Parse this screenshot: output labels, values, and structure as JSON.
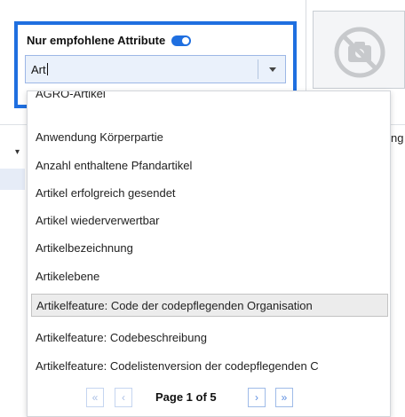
{
  "attribute_filter": {
    "label": "Nur empfohlene Attribute",
    "toggle_on": true,
    "input_value": "Art"
  },
  "background": {
    "partial_text": "ng"
  },
  "dropdown": {
    "options": [
      "AGRO-Artikel",
      "Anwendung Körperpartie",
      "Anzahl enthaltene Pfandartikel",
      "Artikel erfolgreich gesendet",
      "Artikel wiederverwertbar",
      "Artikelbezeichnung",
      "Artikelebene",
      "Artikelfeature: Code der codepflegenden Organisation",
      "Artikelfeature: Codebeschreibung",
      "Artikelfeature: Codelistenversion der codepflegenden C"
    ],
    "highlighted_index": 7
  },
  "pager": {
    "first_icon": "«",
    "prev_icon": "‹",
    "label": "Page 1 of 5",
    "next_icon": "›",
    "last_icon": "»"
  },
  "colors": {
    "accent": "#1f6fe0",
    "input_bg": "#eaf1fb",
    "highlight_bg": "#ececec"
  },
  "icons": {
    "image_placeholder": "no-photo-icon",
    "dropdown": "chevron-down-icon"
  }
}
